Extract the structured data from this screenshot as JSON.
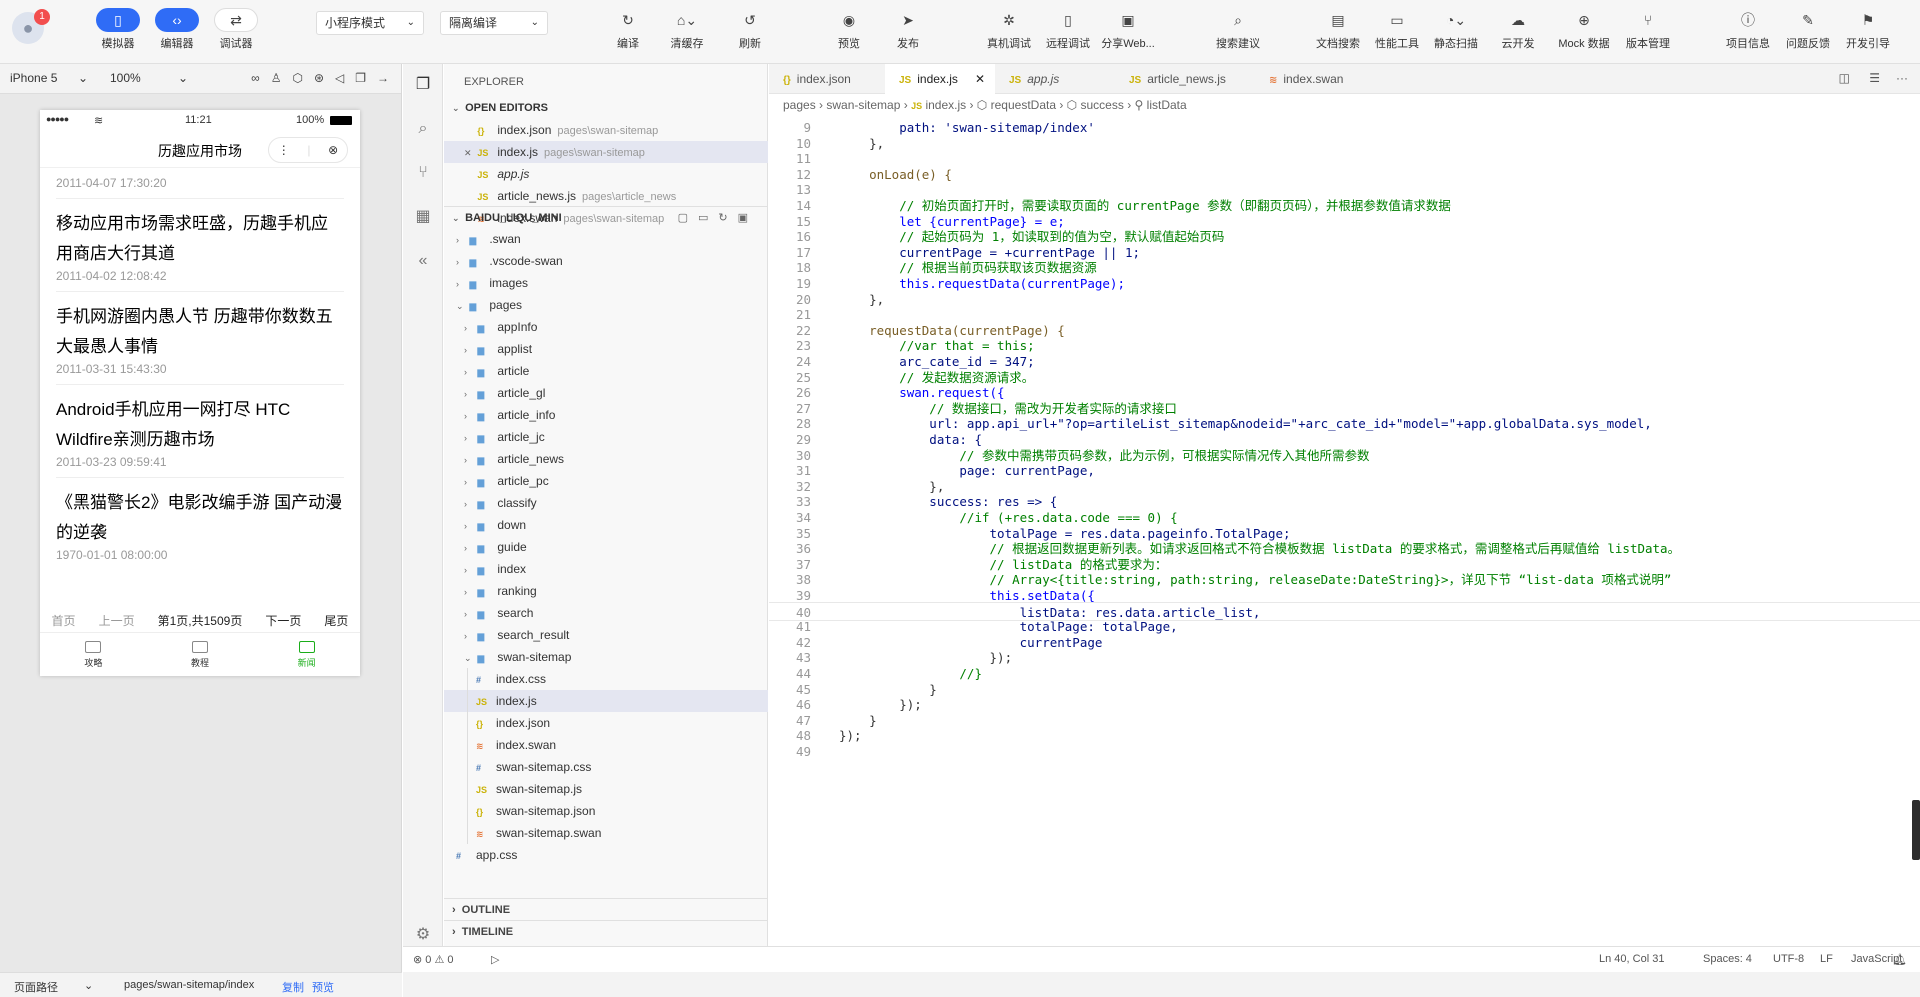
{
  "toolbar": {
    "badge": "1",
    "mode_select": "小程序模式",
    "compile_select": "隔离编译",
    "buttons": {
      "simulator": "模拟器",
      "editor": "编辑器",
      "debugger": "调试器",
      "compile": "编译",
      "clear_cache": "清缓存",
      "refresh": "刷新",
      "preview": "预览",
      "publish": "发布",
      "real_debug": "真机调试",
      "remote_debug": "远程调试",
      "share_web": "分享Web...",
      "search_suggest": "搜索建议",
      "doc_search": "文档搜索",
      "perf_tool": "性能工具",
      "static_scan": "静态扫描",
      "cloud_dev": "云开发",
      "mock_data": "Mock 数据",
      "version_mgmt": "版本管理",
      "project_info": "项目信息",
      "feedback": "问题反馈",
      "dev_guide": "开发引导"
    }
  },
  "simulator": {
    "device": "iPhone 5",
    "zoom": "100%",
    "status": {
      "signal": "●●●●●",
      "time": "11:21",
      "battery": "100%"
    },
    "nav_title": "历趣应用市场",
    "articles": [
      {
        "date": "2011-04-07 17:30:20"
      },
      {
        "title": "移动应用市场需求旺盛，历趣手机应用商店大行其道",
        "date": "2011-04-02 12:08:42"
      },
      {
        "title": "手机网游圈内愚人节 历趣带你数数五大最愚人事情",
        "date": "2011-03-31 15:43:30"
      },
      {
        "title": "Android手机应用一网打尽 HTC Wildfire亲测历趣市场",
        "date": "2011-03-23 09:59:41"
      },
      {
        "title": "《黑猫警长2》电影改编手游 国产动漫的逆袭",
        "date": "1970-01-01 08:00:00"
      }
    ],
    "pager": {
      "first": "首页",
      "prev": "上一页",
      "info": "第1页,共1509页",
      "next": "下一页",
      "last": "尾页"
    },
    "tabs": [
      "攻略",
      "教程",
      "新闻"
    ]
  },
  "pathbar": {
    "label": "页面路径",
    "path": "pages/swan-sitemap/index",
    "copy": "复制",
    "preview": "预览"
  },
  "explorer": {
    "title": "EXPLORER",
    "open_editors": "OPEN EDITORS",
    "project": "BAIDU_LIQU_MINI",
    "open_files": [
      {
        "icon": "{}",
        "name": "index.json",
        "path": "pages\\swan-sitemap"
      },
      {
        "icon": "JS",
        "name": "index.js",
        "path": "pages\\swan-sitemap"
      },
      {
        "icon": "JS",
        "name": "app.js",
        "path": ""
      },
      {
        "icon": "JS",
        "name": "article_news.js",
        "path": "pages\\article_news"
      },
      {
        "icon": "≋",
        "name": "index.swan",
        "path": "pages\\swan-sitemap"
      }
    ],
    "tree": [
      ".swan",
      ".vscode-swan",
      "images",
      "pages",
      "appInfo",
      "applist",
      "article",
      "article_gl",
      "article_info",
      "article_jc",
      "article_news",
      "article_pc",
      "classify",
      "down",
      "guide",
      "index",
      "ranking",
      "search",
      "search_result",
      "swan-sitemap",
      "index.css",
      "index.js",
      "index.json",
      "index.swan",
      "swan-sitemap.css",
      "swan-sitemap.js",
      "swan-sitemap.json",
      "swan-sitemap.swan",
      "app.css"
    ],
    "outline": "OUTLINE",
    "timeline": "TIMELINE"
  },
  "editor": {
    "tabs": [
      "index.json",
      "index.js",
      "app.js",
      "article_news.js",
      "index.swan"
    ],
    "breadcrumbs": [
      "pages",
      "swan-sitemap",
      "index.js",
      "requestData",
      "success",
      "listData"
    ],
    "lines": [
      {
        "n": "9",
        "t": "        path: 'swan-sitemap/index'"
      },
      {
        "n": "10",
        "t": "    },"
      },
      {
        "n": "11",
        "t": ""
      },
      {
        "n": "12",
        "t": "    onLoad(e) {"
      },
      {
        "n": "13",
        "t": ""
      },
      {
        "n": "14",
        "t": "        // 初始页面打开时，需要读取页面的 currentPage 参数（即翻页页码），并根据参数值请求数据"
      },
      {
        "n": "15",
        "t": "        let {currentPage} = e;"
      },
      {
        "n": "16",
        "t": "        // 起始页码为 1，如读取到的值为空，默认赋值起始页码"
      },
      {
        "n": "17",
        "t": "        currentPage = +currentPage || 1;"
      },
      {
        "n": "18",
        "t": "        // 根据当前页码获取该页数据资源"
      },
      {
        "n": "19",
        "t": "        this.requestData(currentPage);"
      },
      {
        "n": "20",
        "t": "    },"
      },
      {
        "n": "21",
        "t": ""
      },
      {
        "n": "22",
        "t": "    requestData(currentPage) {"
      },
      {
        "n": "23",
        "t": "        //var that = this;"
      },
      {
        "n": "24",
        "t": "        arc_cate_id = 347;"
      },
      {
        "n": "25",
        "t": "        // 发起数据资源请求。"
      },
      {
        "n": "26",
        "t": "        swan.request({"
      },
      {
        "n": "27",
        "t": "            // 数据接口，需改为开发者实际的请求接口"
      },
      {
        "n": "28",
        "t": "            url: app.api_url+\"?op=artileList_sitemap&nodeid=\"+arc_cate_id+\"model=\"+app.globalData.sys_model,"
      },
      {
        "n": "29",
        "t": "            data: {"
      },
      {
        "n": "30",
        "t": "                // 参数中需携带页码参数，此为示例，可根据实际情况传入其他所需参数"
      },
      {
        "n": "31",
        "t": "                page: currentPage,"
      },
      {
        "n": "32",
        "t": "            },"
      },
      {
        "n": "33",
        "t": "            success: res => {"
      },
      {
        "n": "34",
        "t": "                //if (+res.data.code === 0) {"
      },
      {
        "n": "35",
        "t": "                    totalPage = res.data.pageinfo.TotalPage;"
      },
      {
        "n": "36",
        "t": "                    // 根据返回数据更新列表。如请求返回格式不符合模板数据 listData 的要求格式，需调整格式后再赋值给 listData。"
      },
      {
        "n": "37",
        "t": "                    // listData 的格式要求为："
      },
      {
        "n": "38",
        "t": "                    // Array<{title:string, path:string, releaseDate:DateString}>，详见下节 “list-data 项格式说明”"
      },
      {
        "n": "39",
        "t": "                    this.setData({"
      },
      {
        "n": "40",
        "t": "                        listData: res.data.article_list,"
      },
      {
        "n": "41",
        "t": "                        totalPage: totalPage,"
      },
      {
        "n": "42",
        "t": "                        currentPage"
      },
      {
        "n": "43",
        "t": "                    });"
      },
      {
        "n": "44",
        "t": "                //}"
      },
      {
        "n": "45",
        "t": "            }"
      },
      {
        "n": "46",
        "t": "        });"
      },
      {
        "n": "47",
        "t": "    }"
      },
      {
        "n": "48",
        "t": "});"
      },
      {
        "n": "49",
        "t": ""
      }
    ]
  },
  "statusbar": {
    "problems": "⊗ 0 ⚠ 0",
    "position": "Ln 40, Col 31",
    "spaces": "Spaces: 4",
    "encoding": "UTF-8",
    "eol": "LF",
    "language": "JavaScript"
  }
}
